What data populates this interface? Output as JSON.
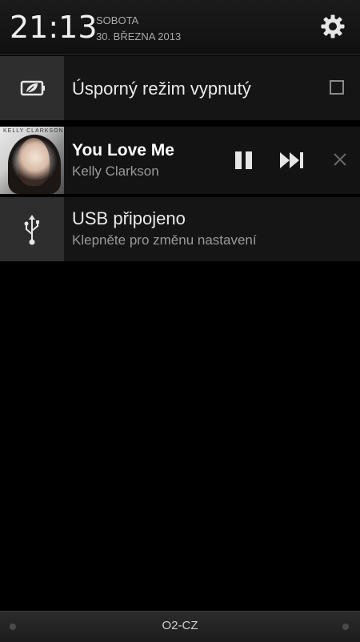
{
  "status_header": {
    "time": "21:13",
    "day": "SOBOTA",
    "date": "30. BŘEZNA 2013",
    "settings_icon": "gear-icon"
  },
  "notifications": {
    "power_saver": {
      "label": "Úsporný režim vypnutý",
      "icon": "battery-leaf-icon",
      "checked": false
    },
    "music": {
      "track": "You Love Me",
      "artist": "Kelly Clarkson",
      "album_text": "KELLY CLARKSON",
      "pause_icon": "pause-icon",
      "next_icon": "skip-next-icon",
      "close_icon": "close-icon"
    },
    "usb": {
      "title": "USB připojeno",
      "subtitle": "Klepněte pro změnu nastavení",
      "icon": "usb-icon"
    }
  },
  "footer": {
    "carrier": "O2-CZ"
  },
  "colors": {
    "background": "#000000",
    "row_background": "#151515",
    "icon_panel": "#2e2e2e",
    "primary_text": "#eaeaea",
    "secondary_text": "#9a9a9a"
  }
}
